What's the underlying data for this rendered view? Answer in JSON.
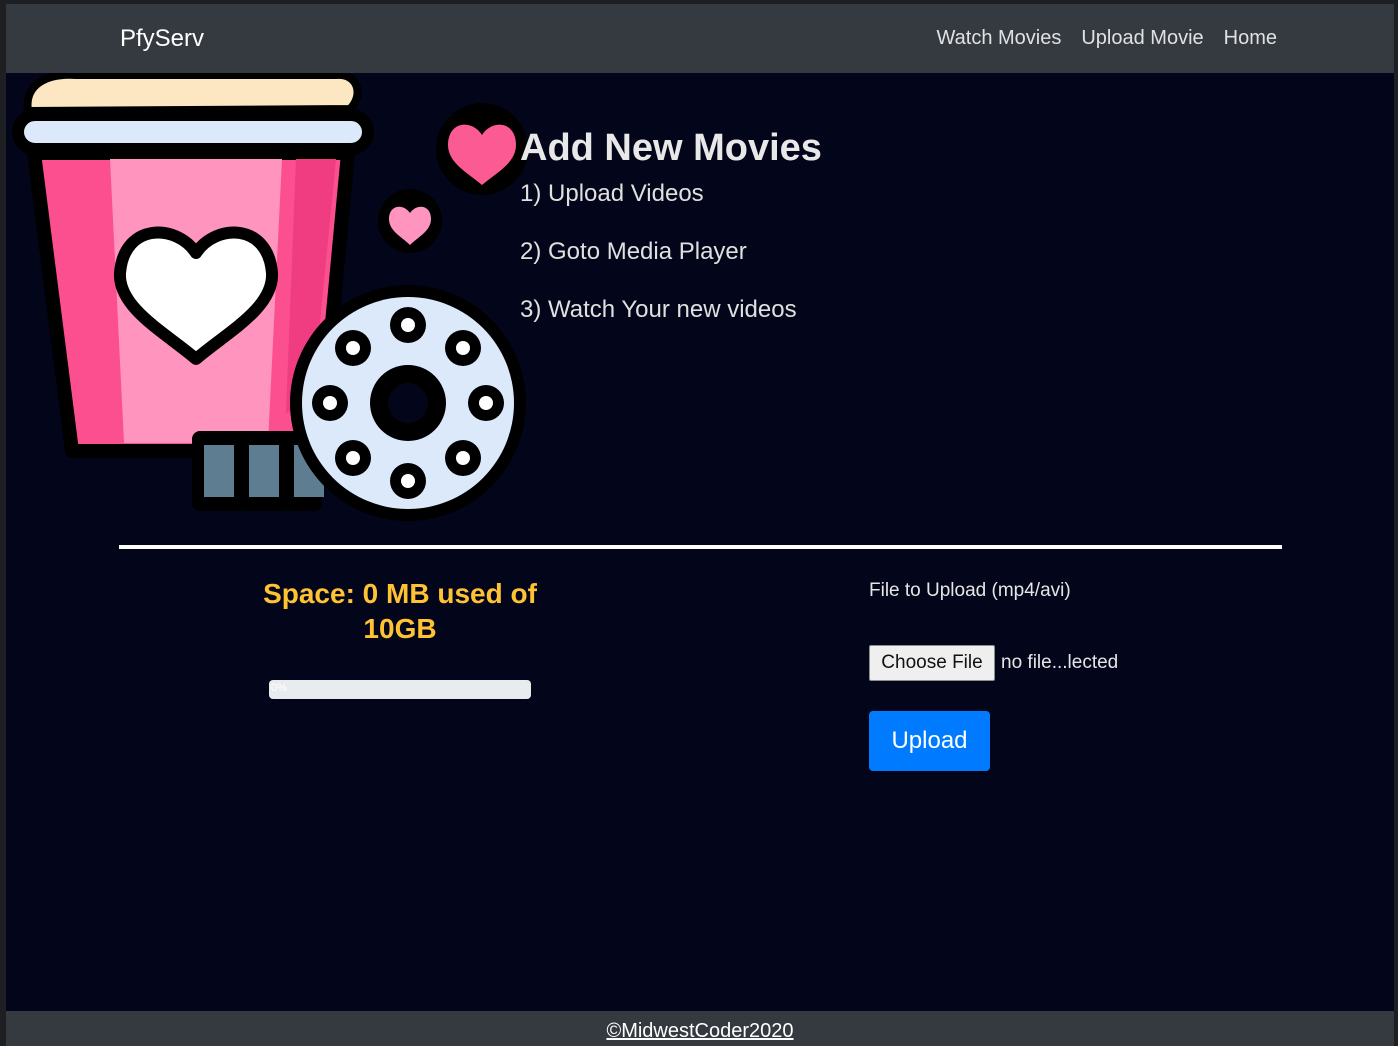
{
  "navbar": {
    "brand": "PfyServ",
    "links": [
      "Watch Movies",
      "Upload Movie",
      "Home"
    ]
  },
  "hero": {
    "title": "Add New Movies",
    "steps": [
      "1) Upload Videos",
      "2) Goto Media Player",
      "3) Watch Your new videos"
    ]
  },
  "storage": {
    "space_text": "Space: 0 MB used of 10GB",
    "progress_label": "0%",
    "progress_value": 0
  },
  "upload": {
    "label": "File to Upload (mp4/avi)",
    "choose_label": "Choose File",
    "file_status": "no file...lected",
    "upload_label": "Upload"
  },
  "footer": {
    "copyright": "©MidwestCoder2020"
  },
  "colors": {
    "navbar": "#343a40",
    "background": "#03061a",
    "accent": "#007bff",
    "space_text": "#ffc233"
  }
}
